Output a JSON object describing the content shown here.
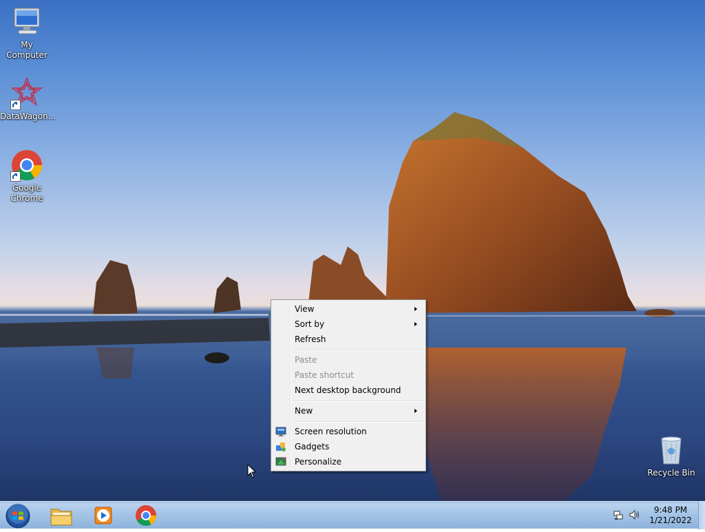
{
  "desktop": {
    "icons": [
      {
        "label": "My Computer",
        "icon": "computer-icon"
      },
      {
        "label": "DataWagon...",
        "icon": "datawagon-icon",
        "shortcut": true
      },
      {
        "label": "Google Chrome",
        "icon": "chrome-icon",
        "shortcut": true
      },
      {
        "label": "Recycle Bin",
        "icon": "recycle-bin-icon"
      }
    ]
  },
  "context_menu": {
    "items": [
      {
        "label": "View",
        "has_submenu": true,
        "enabled": true
      },
      {
        "label": "Sort by",
        "has_submenu": true,
        "enabled": true
      },
      {
        "label": "Refresh",
        "enabled": true
      },
      {
        "label": "Paste",
        "enabled": false
      },
      {
        "label": "Paste shortcut",
        "enabled": false
      },
      {
        "label": "Next desktop background",
        "enabled": true
      },
      {
        "label": "New",
        "has_submenu": true,
        "enabled": true
      },
      {
        "label": "Screen resolution",
        "icon": "screen-resolution-icon",
        "enabled": true
      },
      {
        "label": "Gadgets",
        "icon": "gadgets-icon",
        "enabled": true
      },
      {
        "label": "Personalize",
        "icon": "personalize-icon",
        "enabled": true
      }
    ]
  },
  "taskbar": {
    "pinned": [
      {
        "name": "File Explorer",
        "icon": "folder-icon"
      },
      {
        "name": "Windows Media Player",
        "icon": "media-player-icon"
      },
      {
        "name": "Google Chrome",
        "icon": "chrome-icon"
      }
    ],
    "tray": {
      "time": "9:48 PM",
      "date": "1/21/2022",
      "icons": [
        "network-icon",
        "volume-icon"
      ]
    }
  }
}
